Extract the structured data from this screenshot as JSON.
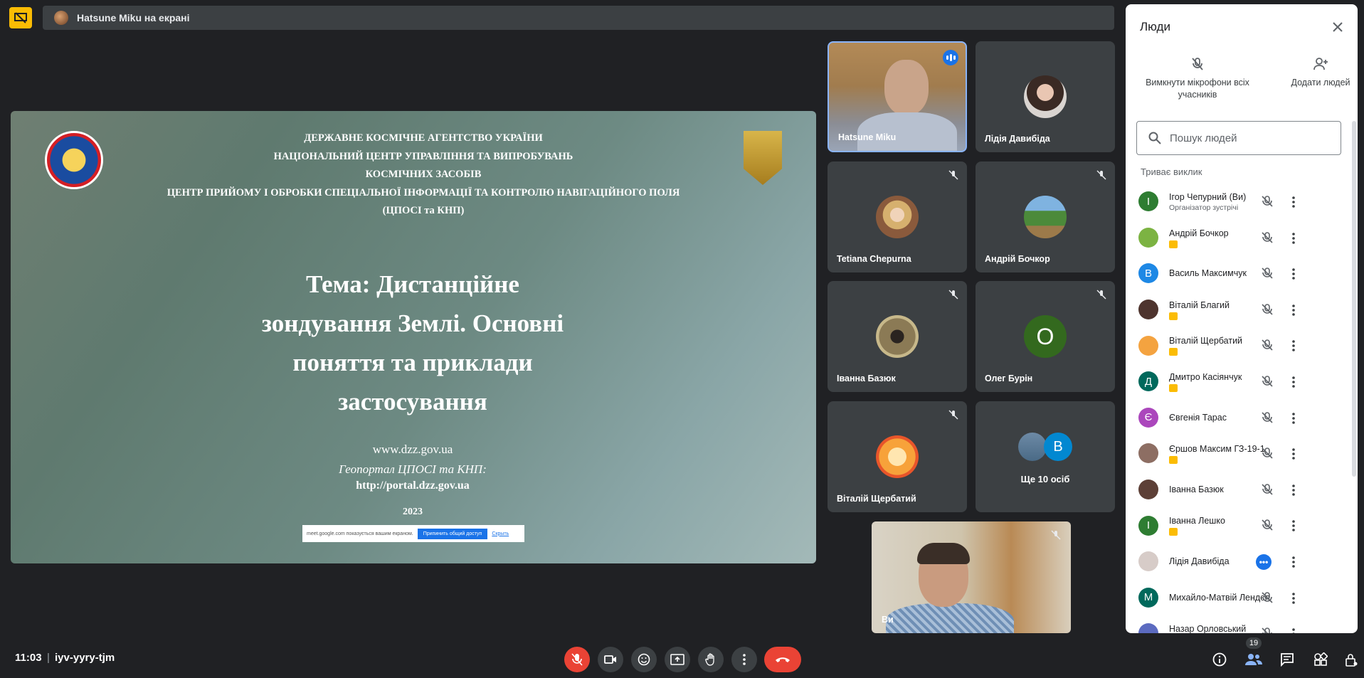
{
  "banner": {
    "presenter_text": "Hatsune Miku на екрані"
  },
  "slide": {
    "header_lines": [
      "ДЕРЖАВНЕ КОСМІЧНЕ АГЕНТСТВО УКРАЇНИ",
      "НАЦІОНАЛЬНИЙ ЦЕНТР УПРАВЛІННЯ ТА ВИПРОБУВАНЬ",
      "КОСМІЧНИХ ЗАСОБІВ",
      "ЦЕНТР ПРИЙОМУ І ОБРОБКИ СПЕЦІАЛЬНОЇ ІНФОРМАЦІЇ ТА  КОНТРОЛЮ НАВІГАЦІЙНОГО ПОЛЯ",
      "(ЦПОСІ та КНП)"
    ],
    "topic_lines": [
      "Тема:  Дистанційне",
      "зондування Землі. Основні",
      "поняття та приклади",
      "застосування"
    ],
    "site": "www.dzz.gov.ua",
    "geoportal": "Геопортал ЦПОСІ та КНП:",
    "portal": "http://portal.dzz.gov.ua",
    "year": "2023",
    "share_notice": {
      "text": "meet.google.com показується вашим екраном.",
      "stop_label": "Припинить общий доступ",
      "hide_label": "Скрыть"
    }
  },
  "tiles": [
    {
      "name": "Hatsune Miku",
      "kind": "video-speaking"
    },
    {
      "name": "Лідія Давибіда",
      "kind": "avatar"
    },
    {
      "name": "Tetiana Chepurna",
      "kind": "avatar-muted"
    },
    {
      "name": "Андрій Бочкор",
      "kind": "avatar-muted"
    },
    {
      "name": "Іванна Базюк",
      "kind": "avatar-muted"
    },
    {
      "name": "Олег Бурін",
      "kind": "letter-muted",
      "letter": "О",
      "color": "#33691e"
    },
    {
      "name": "Віталій Щербатий",
      "kind": "avatar-muted"
    },
    {
      "name": "Ще 10 осіб",
      "kind": "more",
      "letter": "В"
    }
  ],
  "self_view": {
    "name": "Ви"
  },
  "people_panel": {
    "title": "Люди",
    "mute_all_label": "Вимкнути мікрофони всіх учасників",
    "add_people_label": "Додати людей",
    "search_placeholder": "Пошук людей",
    "section_label": "Триває виклик",
    "participants": [
      {
        "name": "Ігор Чепурний (Ви)",
        "subtitle": "Організатор зустрічі",
        "letter": "І",
        "color": "#2e7d32",
        "badge": false
      },
      {
        "name": "Андрій Бочкор",
        "subtitle": "",
        "letter": "",
        "color": "#7cb342",
        "badge": true
      },
      {
        "name": "Василь Максимчук",
        "subtitle": "",
        "letter": "В",
        "color": "#1e88e5",
        "badge": false
      },
      {
        "name": "Віталій Благий",
        "subtitle": "",
        "letter": "",
        "color": "#4e342e",
        "badge": true
      },
      {
        "name": "Віталій Щербатий",
        "subtitle": "",
        "letter": "",
        "color": "#f4a340",
        "badge": true
      },
      {
        "name": "Дмитро Касіянчук",
        "subtitle": "",
        "letter": "Д",
        "color": "#00695c",
        "badge": true
      },
      {
        "name": "Євгенія Тарас",
        "subtitle": "",
        "letter": "Є",
        "color": "#ab47bc",
        "badge": false
      },
      {
        "name": "Єршов Максим ГЗ-19-1",
        "subtitle": "",
        "letter": "",
        "color": "#8d6e63",
        "badge": true
      },
      {
        "name": "Іванна Базюк",
        "subtitle": "",
        "letter": "",
        "color": "#5d4037",
        "badge": false
      },
      {
        "name": "Іванна Лешко",
        "subtitle": "",
        "letter": "І",
        "color": "#2e7d32",
        "badge": true
      },
      {
        "name": "Лідія Давибіда",
        "subtitle": "",
        "letter": "",
        "color": "#d7ccc8",
        "badge": false,
        "talking": true
      },
      {
        "name": "Михайло-Матвій Лендєл",
        "subtitle": "",
        "letter": "М",
        "color": "#00695c",
        "badge": false
      },
      {
        "name": "Назар Орловський",
        "subtitle": "",
        "letter": "",
        "color": "#5c6bc0",
        "badge": true
      }
    ]
  },
  "bottom_bar": {
    "time": "11:03",
    "separator": "|",
    "meeting_code": "iyv-yyry-tjm",
    "participant_count": "19"
  },
  "colors": {
    "accent": "#1a73e8",
    "danger": "#ea4335",
    "presenting": "#fbbc04"
  }
}
